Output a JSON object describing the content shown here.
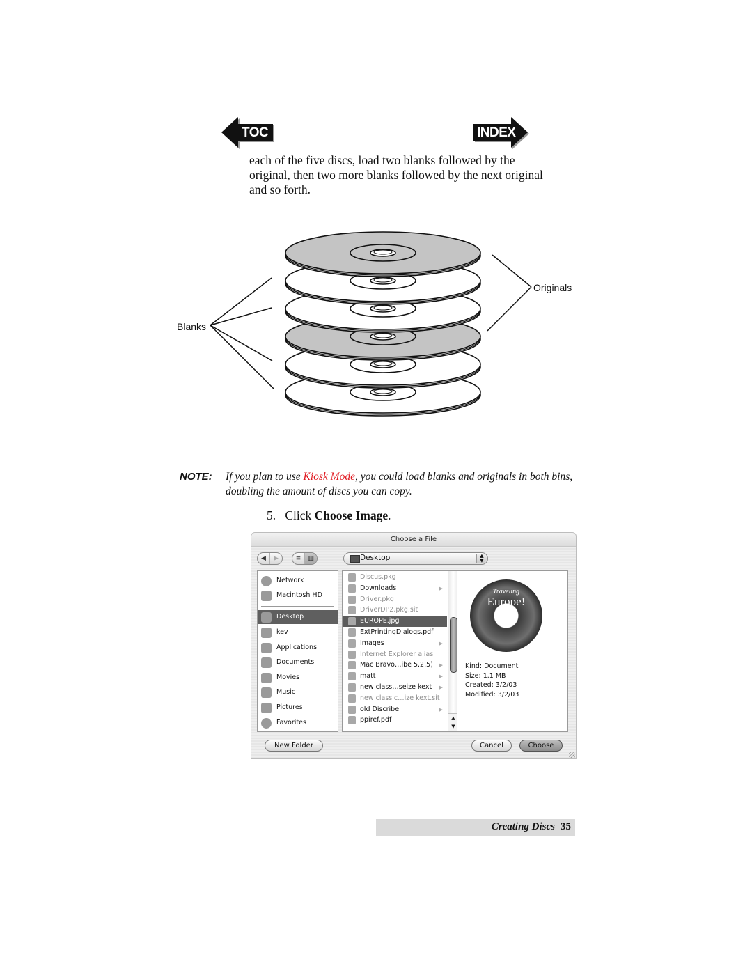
{
  "nav": {
    "toc_label": "TOC",
    "index_label": "INDEX"
  },
  "body_text": "each of the five discs, load two blanks followed by the original, then two more blanks followed by the next original and so forth.",
  "figure": {
    "label_blanks": "Blanks",
    "label_originals": "Originals",
    "discs": [
      {
        "type": "original"
      },
      {
        "type": "blank"
      },
      {
        "type": "blank"
      },
      {
        "type": "original"
      },
      {
        "type": "blank"
      },
      {
        "type": "blank"
      }
    ],
    "colors": {
      "original_fill": "#c4c4c4",
      "blank_fill": "#ffffff"
    }
  },
  "note": {
    "heading": "NOTE:",
    "text_before": "If you plan to use ",
    "link": "Kiosk Mode",
    "text_after": ", you could load blanks and originals in both bins, doubling the amount of discs you can copy.",
    "link_color": "#e0181f"
  },
  "step": {
    "number": "5.",
    "text_before": "Click ",
    "bold": "Choose Image",
    "text_after": "."
  },
  "dialog": {
    "title": "Choose a File",
    "location": "Desktop",
    "back_icon": "◀",
    "forward_icon": "▶",
    "list_view_icon": "≡",
    "column_view_icon": "▥",
    "sidebar": [
      {
        "label": "Network",
        "icon": "network-icon"
      },
      {
        "label": "Macintosh HD",
        "icon": "hard-drive-icon"
      },
      {
        "label": "Desktop",
        "icon": "desktop-icon",
        "selected": true
      },
      {
        "label": "kev",
        "icon": "home-icon"
      },
      {
        "label": "Applications",
        "icon": "applications-icon"
      },
      {
        "label": "Documents",
        "icon": "documents-icon"
      },
      {
        "label": "Movies",
        "icon": "movies-icon"
      },
      {
        "label": "Music",
        "icon": "music-icon"
      },
      {
        "label": "Pictures",
        "icon": "pictures-icon"
      },
      {
        "label": "Favorites",
        "icon": "favorites-icon"
      }
    ],
    "files": [
      {
        "name": "Discus.pkg",
        "dim": true,
        "folder": false
      },
      {
        "name": "Downloads",
        "dim": false,
        "folder": true
      },
      {
        "name": "Driver.pkg",
        "dim": true,
        "folder": false
      },
      {
        "name": "DriverDP2.pkg.sit",
        "dim": true,
        "folder": false
      },
      {
        "name": "EUROPE.jpg",
        "dim": false,
        "folder": false,
        "selected": true
      },
      {
        "name": "ExtPrintingDialogs.pdf",
        "dim": false,
        "folder": false
      },
      {
        "name": "Images",
        "dim": false,
        "folder": true
      },
      {
        "name": "Internet Explorer alias",
        "dim": true,
        "folder": false
      },
      {
        "name": "Mac Bravo…ibe 5.2.5)",
        "dim": false,
        "folder": true
      },
      {
        "name": "matt",
        "dim": false,
        "folder": true
      },
      {
        "name": "new class…seize kext",
        "dim": false,
        "folder": true
      },
      {
        "name": "new classic…ize kext.sit",
        "dim": true,
        "folder": false
      },
      {
        "name": "old Discribe",
        "dim": false,
        "folder": true
      },
      {
        "name": "ppiref.pdf",
        "dim": false,
        "folder": false
      }
    ],
    "preview": {
      "image_title_1": "Traveling",
      "image_title_2": "Europe!",
      "kind": "Kind: Document",
      "size": "Size: 1.1 MB",
      "created": "Created: 3/2/03",
      "modified": "Modified: 3/2/03"
    },
    "buttons": {
      "new_folder": "New Folder",
      "cancel": "Cancel",
      "choose": "Choose"
    }
  },
  "footer": {
    "section": "Creating Discs",
    "page": "35"
  }
}
